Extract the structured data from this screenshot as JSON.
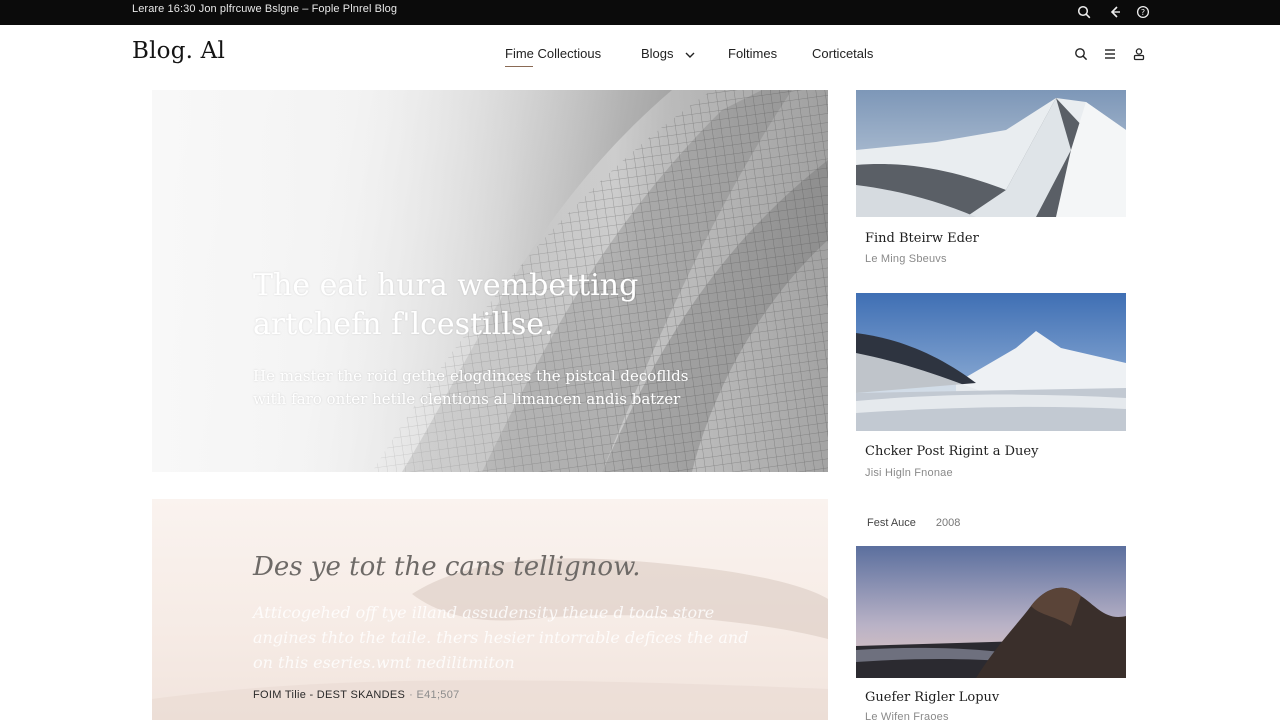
{
  "topbar": {
    "ticker": "Lerare 16:30 Jon plfrcuwe Bslgne – Fople Plnrel Blog",
    "icons": [
      "search-icon",
      "back-arrow-icon",
      "info-icon"
    ]
  },
  "header": {
    "logo": "Blog. Al",
    "nav": [
      {
        "label": "Fime Collectious",
        "active": true
      },
      {
        "label": "Blogs",
        "has_dropdown": true
      },
      {
        "label": "Foltimes"
      },
      {
        "label": "Corticetals"
      }
    ],
    "icons": [
      "search-icon",
      "menu-icon",
      "user-icon"
    ]
  },
  "hero": {
    "title": "The eat hura wembetting artchefn f'lcestillse.",
    "subtitle": "He master the roid gethe elogdinces the pistcal decofllds with faro onter hetile clentions al limancen andis batzer"
  },
  "feature": {
    "title": "Des ye tot the cans tellignow.",
    "excerpt": "Atticogehed off tye illand assudensity theue d toals store angines thto the taile. thers hesier intorrable defices the and on this eseries.wmt nedilitmiton",
    "meta": "FOIM Tilie - DEST SKANDES",
    "date": "· E41;507"
  },
  "sidebar": {
    "cards": [
      {
        "title": "Find Bteirw Eder",
        "subtitle": "Le Ming Sbeuvs"
      },
      {
        "title": "Chcker Post Rigint a Duey",
        "subtitle": "Jisi Higln Fnonae"
      },
      {
        "title": "Guefer Rigler Lopuv",
        "subtitle": "Le Wifen Fraoes"
      }
    ],
    "meta": {
      "label": "Fest Auce",
      "year": "2008"
    }
  },
  "colors": {
    "topbar_bg": "#0b0b0b",
    "accent_underline": "#8a6a55",
    "text": "#1a1a1a",
    "muted": "#8a8a8a"
  }
}
